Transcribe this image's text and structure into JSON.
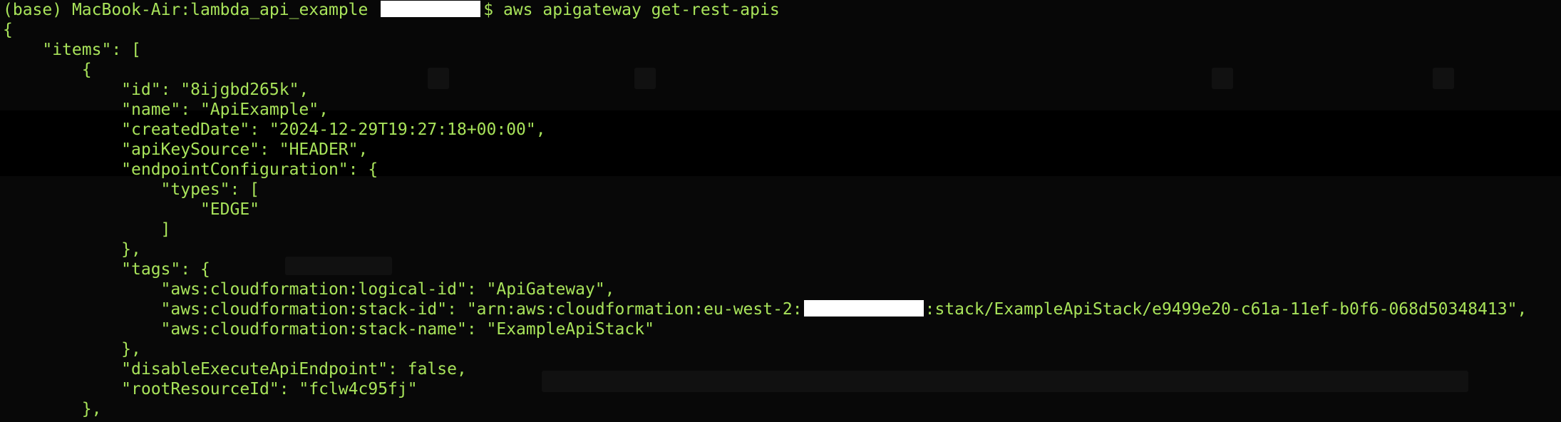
{
  "prompt": {
    "env": "(base)",
    "host_path": "MacBook-Air:lambda_api_example",
    "symbol": "$",
    "command": "aws apigateway get-rest-apis"
  },
  "output": {
    "l01": "{",
    "l02": "    \"items\": [",
    "l03": "        {",
    "l04": "            \"id\": \"8ijgbd265k\",",
    "l05": "            \"name\": \"ApiExample\",",
    "l06": "            \"createdDate\": \"2024-12-29T19:27:18+00:00\",",
    "l07": "            \"apiKeySource\": \"HEADER\",",
    "l08": "            \"endpointConfiguration\": {",
    "l09": "                \"types\": [",
    "l10": "                    \"EDGE\"",
    "l11": "                ]",
    "l12": "            },",
    "l13": "            \"tags\": {",
    "l14": "                \"aws:cloudformation:logical-id\": \"ApiGateway\",",
    "l15a": "                \"aws:cloudformation:stack-id\": \"arn:aws:cloudformation:eu-west-2:",
    "l15b": ":stack/ExampleApiStack/e9499e20-c61a-11ef-b0f6-068d50348413\",",
    "l16": "                \"aws:cloudformation:stack-name\": \"ExampleApiStack\"",
    "l17": "            },",
    "l18": "            \"disableExecuteApiEndpoint\": false,",
    "l19": "            \"rootResourceId\": \"fclw4c95fj\"",
    "l20": "        },"
  },
  "colors": {
    "background": "#000000",
    "text": "#a8e35a",
    "redaction": "#ffffff"
  }
}
